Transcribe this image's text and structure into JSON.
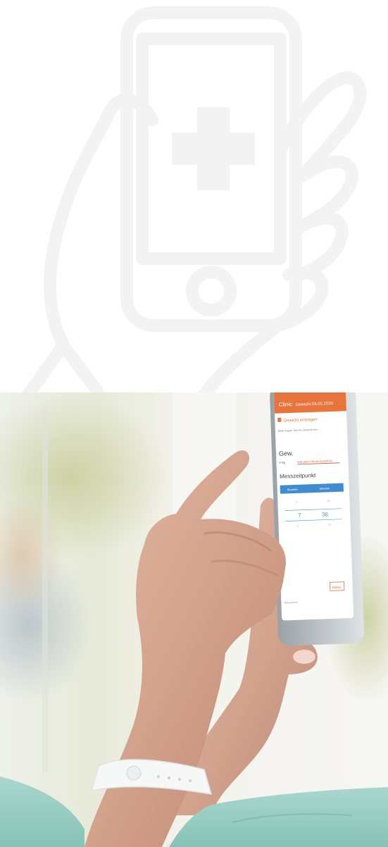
{
  "phone_screen": {
    "header_left": "Clinic",
    "header_title": "Gewicht 08.03.2020",
    "section_title": "Gewicht eintragen",
    "helper_text": "Bitte tragen Sie ein Gewicht ein",
    "field_label": "Gew.",
    "unit_label": "in kg",
    "error_text": "Bitte geben Sie ein Gewicht an",
    "time_label": "Messzeitpunkt",
    "col_hour": "Stunden",
    "col_minute": "Minuten",
    "picker_hour": "7",
    "picker_minute": "36",
    "cancel_label": "Abbrechen",
    "save_label": "Weiter"
  }
}
